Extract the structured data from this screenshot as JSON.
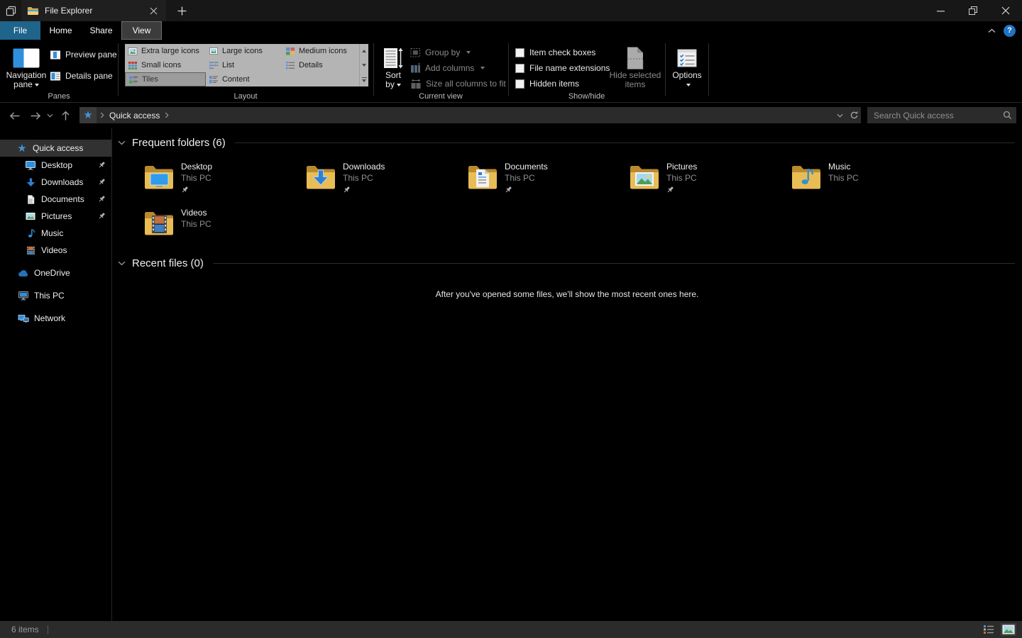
{
  "colors": {
    "accent_blue": "#2f8fdd",
    "file_tab_teal": "#1f648a",
    "folder_front": "#e9bd55",
    "folder_back": "#b98a2e",
    "help_blue": "#2173c4"
  },
  "titlebar": {
    "tab_title": "File Explorer"
  },
  "menubar": {
    "tabs": [
      "File",
      "Home",
      "Share",
      "View"
    ],
    "active_tab": "View",
    "help_label": "?"
  },
  "ribbon": {
    "panes": {
      "group_label": "Panes",
      "navigation_pane_line1": "Navigation",
      "navigation_pane_line2": "pane",
      "preview_pane": "Preview pane",
      "details_pane": "Details pane"
    },
    "layout": {
      "group_label": "Layout",
      "selected_item": "Tiles",
      "items": [
        "Extra large icons",
        "Large icons",
        "Medium icons",
        "Small icons",
        "List",
        "Details",
        "Tiles",
        "Content"
      ]
    },
    "current_view": {
      "group_label": "Current view",
      "sort_by_line1": "Sort",
      "sort_by_line2": "by",
      "group_by": "Group by",
      "add_columns": "Add columns",
      "size_all_columns": "Size all columns to fit"
    },
    "show_hide": {
      "group_label": "Show/hide",
      "checkboxes": [
        "Item check boxes",
        "File name extensions",
        "Hidden items"
      ],
      "hide_selected_line1": "Hide selected",
      "hide_selected_line2": "items"
    },
    "options": {
      "label": "Options"
    }
  },
  "addressbar": {
    "location": "Quick access",
    "search_placeholder": "Search Quick access"
  },
  "sidebar": {
    "items": [
      {
        "label": "Quick access",
        "selected": true
      },
      {
        "label": "Desktop",
        "pinned": true
      },
      {
        "label": "Downloads",
        "pinned": true
      },
      {
        "label": "Documents",
        "pinned": true
      },
      {
        "label": "Pictures",
        "pinned": true
      },
      {
        "label": "Music",
        "pinned": false
      },
      {
        "label": "Videos",
        "pinned": false
      },
      {
        "label": "OneDrive",
        "pinned": false
      },
      {
        "label": "This PC",
        "pinned": false
      },
      {
        "label": "Network",
        "pinned": false
      }
    ]
  },
  "main": {
    "frequent": {
      "title": "Frequent folders (6)",
      "items": [
        {
          "name": "Desktop",
          "location": "This PC",
          "pinned": true
        },
        {
          "name": "Downloads",
          "location": "This PC",
          "pinned": true
        },
        {
          "name": "Documents",
          "location": "This PC",
          "pinned": true
        },
        {
          "name": "Pictures",
          "location": "This PC",
          "pinned": true
        },
        {
          "name": "Music",
          "location": "This PC",
          "pinned": false
        },
        {
          "name": "Videos",
          "location": "This PC",
          "pinned": false
        }
      ]
    },
    "recent": {
      "title": "Recent files (0)",
      "empty_message": "After you've opened some files, we'll show the most recent ones here."
    }
  },
  "statusbar": {
    "item_count": "6 items"
  }
}
